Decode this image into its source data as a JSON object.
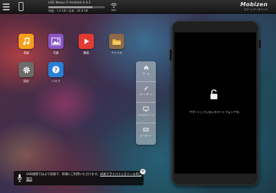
{
  "topbar": {
    "device_name": "LGE Nexus 5  Android 4.4.2",
    "storage_text": "残量：1.0 GB / 全体：26.8 GB",
    "storage_fraction": 0.78,
    "wifi_label": "WiFi",
    "brand": "Mobizen",
    "brand_sub": "スマートデータリンク"
  },
  "apps": [
    {
      "label": "音楽",
      "icon": "music-icon",
      "color": "#f4a01c"
    },
    {
      "label": "写真",
      "icon": "photo-icon",
      "color": "#8a56c4"
    },
    {
      "label": "動画",
      "icon": "video-play-icon",
      "color": "#e23b33"
    },
    {
      "label": "ファイル",
      "icon": "folder-icon",
      "color": "#8a6a48"
    },
    {
      "label": "設定",
      "icon": "gear-icon",
      "color": "#6c6c6c"
    },
    {
      "label": "ヘルプ",
      "icon": "help-icon",
      "color": "#2a7fd6"
    }
  ],
  "toolbar": {
    "items": [
      {
        "label": "ホーム",
        "icon": "home-icon"
      },
      {
        "label": "ペン / ボード",
        "icon": "pen-icon"
      },
      {
        "label": "フルスクリーン",
        "icon": "fullscreen-icon"
      },
      {
        "label": "キーボード",
        "icon": "keyboard-icon"
      }
    ]
  },
  "phone": {
    "screen_message": "サポートしていないスマートフォンです。"
  },
  "notice": {
    "text": "USB接続ではより高速で、快適にご利用いただけます。",
    "link_text": "USBドライバインストールのご案内",
    "close": "×"
  }
}
